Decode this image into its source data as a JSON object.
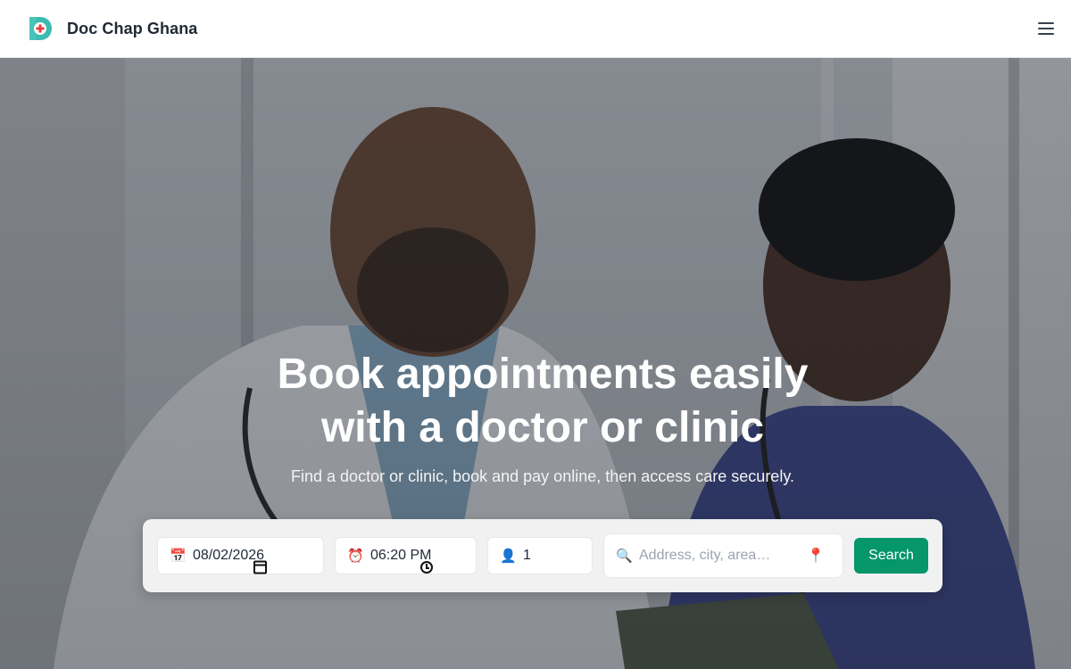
{
  "header": {
    "brand": "Doc Chap Ghana",
    "logo_icon": "logo-d-cross-icon",
    "menu_icon": "hamburger-menu-icon"
  },
  "hero": {
    "title_line1": "Book appointments easily",
    "title_line2": "with a doctor or clinic",
    "subtitle": "Find a doctor or clinic, book and pay online, then access care securely."
  },
  "search": {
    "date_icon": "📅",
    "date_value": "08/02/2026",
    "time_icon": "⏰",
    "time_value": "06:20 PM",
    "people_icon": "👤",
    "people_value": "1",
    "location_icon": "🔍",
    "location_placeholder": "Address, city, area…",
    "location_pin_icon": "📍",
    "button_label": "Search"
  },
  "colors": {
    "brand_teal": "#3dbbb0",
    "brand_red": "#e53e3e",
    "search_button": "#059669"
  }
}
